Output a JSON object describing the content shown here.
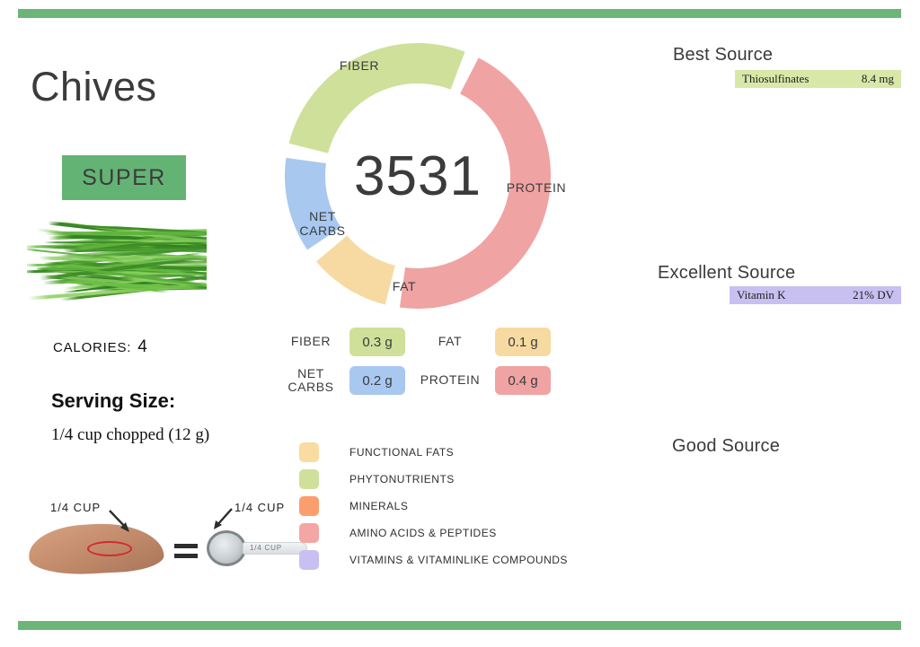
{
  "theme": {
    "rule_color": "#6cb577",
    "badge_color": "#63b474",
    "text_dark": "#3b3b3b"
  },
  "food": {
    "name": "Chives",
    "badge": "SUPER",
    "photo_alt": "chives-bundle"
  },
  "calories": {
    "label": "CALORIES:",
    "value": "4"
  },
  "serving": {
    "heading": "Serving Size:",
    "text": "1/4 cup chopped (12 g)"
  },
  "equivalence": {
    "hand_label": "1/4 CUP",
    "cup_label": "1/4 CUP",
    "cup_handle_label": "1/4  CUP",
    "equals": "="
  },
  "chart_data": {
    "type": "pie",
    "title": "",
    "center_value": "3531",
    "legend_position": "below",
    "categories": [
      "PROTEIN",
      "FAT",
      "NET CARBS",
      "FIBER"
    ],
    "values": [
      0.4,
      0.1,
      0.2,
      0.3
    ],
    "units": "g",
    "slices": [
      {
        "label": "PROTEIN",
        "value": 0.4,
        "display": "0.4 g",
        "color": "#f0a3a3",
        "start_deg": 25,
        "end_deg": 190
      },
      {
        "label": "FAT",
        "value": 0.1,
        "display": "0.1 g",
        "color": "#f7daa1",
        "start_deg": 192,
        "end_deg": 232
      },
      {
        "label": "NET CARBS",
        "value": 0.2,
        "display": "0.2 g",
        "color": "#a8c8f0",
        "start_deg": 234,
        "end_deg": 280
      },
      {
        "label": "FIBER",
        "value": 0.3,
        "display": "0.3 g",
        "color": "#cfe09a",
        "start_deg": 282,
        "end_deg": 383
      }
    ]
  },
  "macros": [
    {
      "name": "FIBER",
      "amount": "0.3 g",
      "color": "#cfe09a"
    },
    {
      "name": "FAT",
      "amount": "0.1 g",
      "color": "#f7daa1"
    },
    {
      "name": "NET\nCARBS",
      "name_line1": "NET",
      "name_line2": "CARBS",
      "amount": "0.2 g",
      "color": "#a8c8f0"
    },
    {
      "name": "PROTEIN",
      "amount": "0.4 g",
      "color": "#f0a3a3"
    }
  ],
  "legend": [
    {
      "label": "FUNCTIONAL  FATS",
      "color": "#f9dca1"
    },
    {
      "label": "PHYTONUTRIENTS",
      "color": "#cfe09a"
    },
    {
      "label": "MINERALS",
      "color": "#fb9e6e"
    },
    {
      "label": "AMINO ACIDS & PEPTIDES",
      "color": "#f3a6a3"
    },
    {
      "label": "VITAMINS & VITAMINLIKE COMPOUNDS",
      "color": "#c8c0f0"
    }
  ],
  "sources": {
    "best": {
      "heading": "Best Source",
      "items": [
        {
          "nutrient": "Thiosulfinates",
          "amount": "8.4 mg",
          "color": "#d8e8a8"
        }
      ]
    },
    "excellent": {
      "heading": "Excellent Source",
      "items": [
        {
          "nutrient": "Vitamin K",
          "amount": "21% DV",
          "color": "#c8c0f0"
        }
      ]
    },
    "good": {
      "heading": "Good Source",
      "items": []
    }
  }
}
